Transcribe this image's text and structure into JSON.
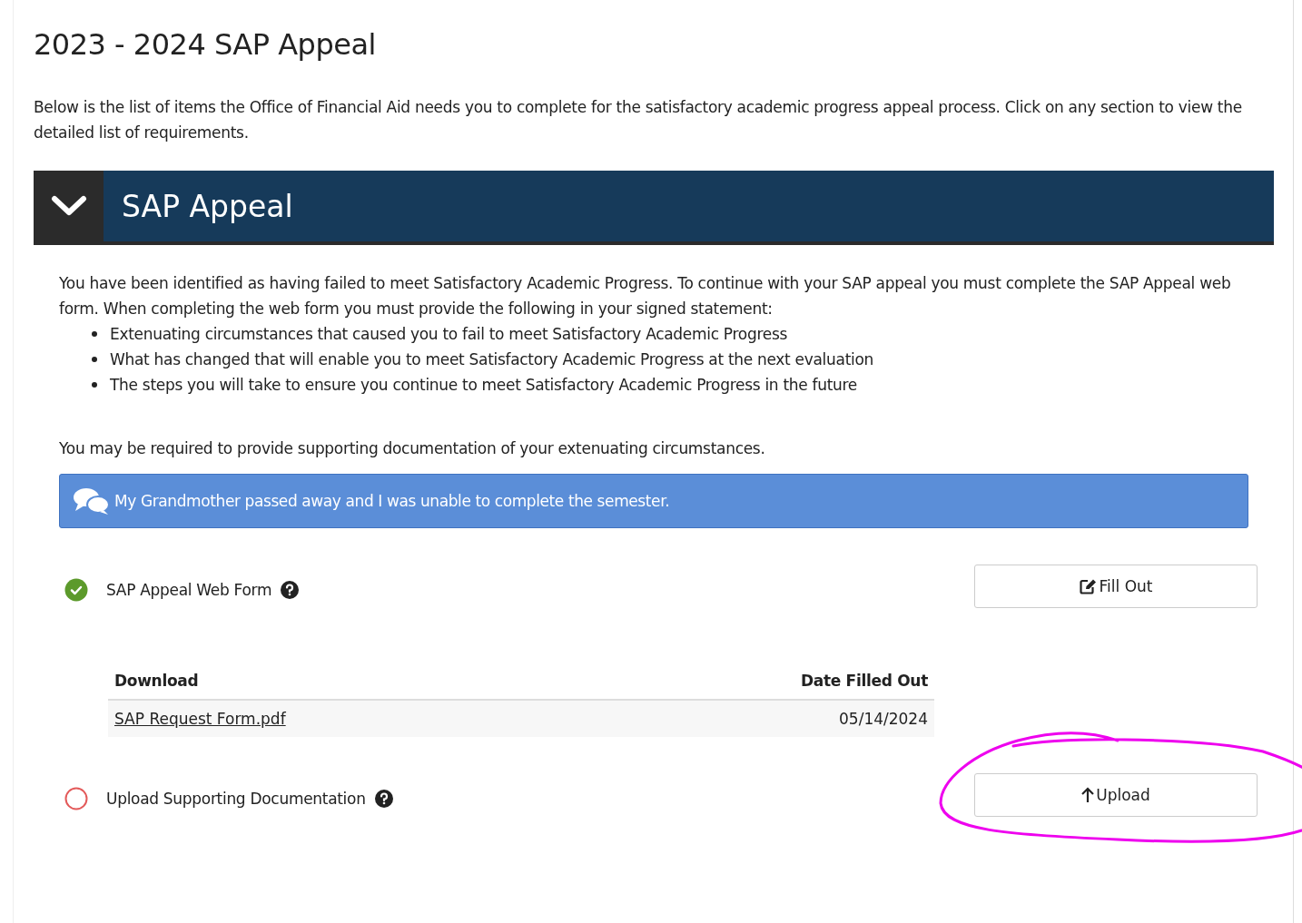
{
  "title": "2023 - 2024 SAP Appeal",
  "intro": "Below is the list of items the Office of Financial Aid needs you to complete for the satisfactory academic progress appeal process. Click on any section to view the detailed list of requirements.",
  "section": {
    "title": "SAP Appeal",
    "expanded": true,
    "description": "You have been identified as having failed to meet Satisfactory Academic Progress. To continue with your SAP appeal you must complete the SAP Appeal web form. When completing the web form you must provide the following in your signed statement:",
    "bullets": [
      "Extenuating circumstances that caused you to fail to meet Satisfactory Academic Progress",
      "What has changed that will enable you to meet Satisfactory Academic Progress at the next evaluation",
      "The steps you will take to ensure you continue to meet Satisfactory Academic Progress in the future"
    ],
    "note": "You may be required to provide supporting documentation of your extenuating circumstances.",
    "comment": "My Grandmother passed away and I was unable to complete the semester.",
    "items": [
      {
        "label": "SAP Appeal Web Form",
        "complete": true,
        "button": {
          "kind": "edit",
          "label": "Fill Out"
        },
        "table": {
          "columns": [
            "Download",
            "Date Filled Out"
          ],
          "rows": [
            {
              "file": "SAP Request Form.pdf",
              "date": "05/14/2024"
            }
          ]
        }
      },
      {
        "label": "Upload Supporting Documentation",
        "complete": false,
        "button": {
          "kind": "upload",
          "label": "Upload"
        }
      }
    ]
  }
}
